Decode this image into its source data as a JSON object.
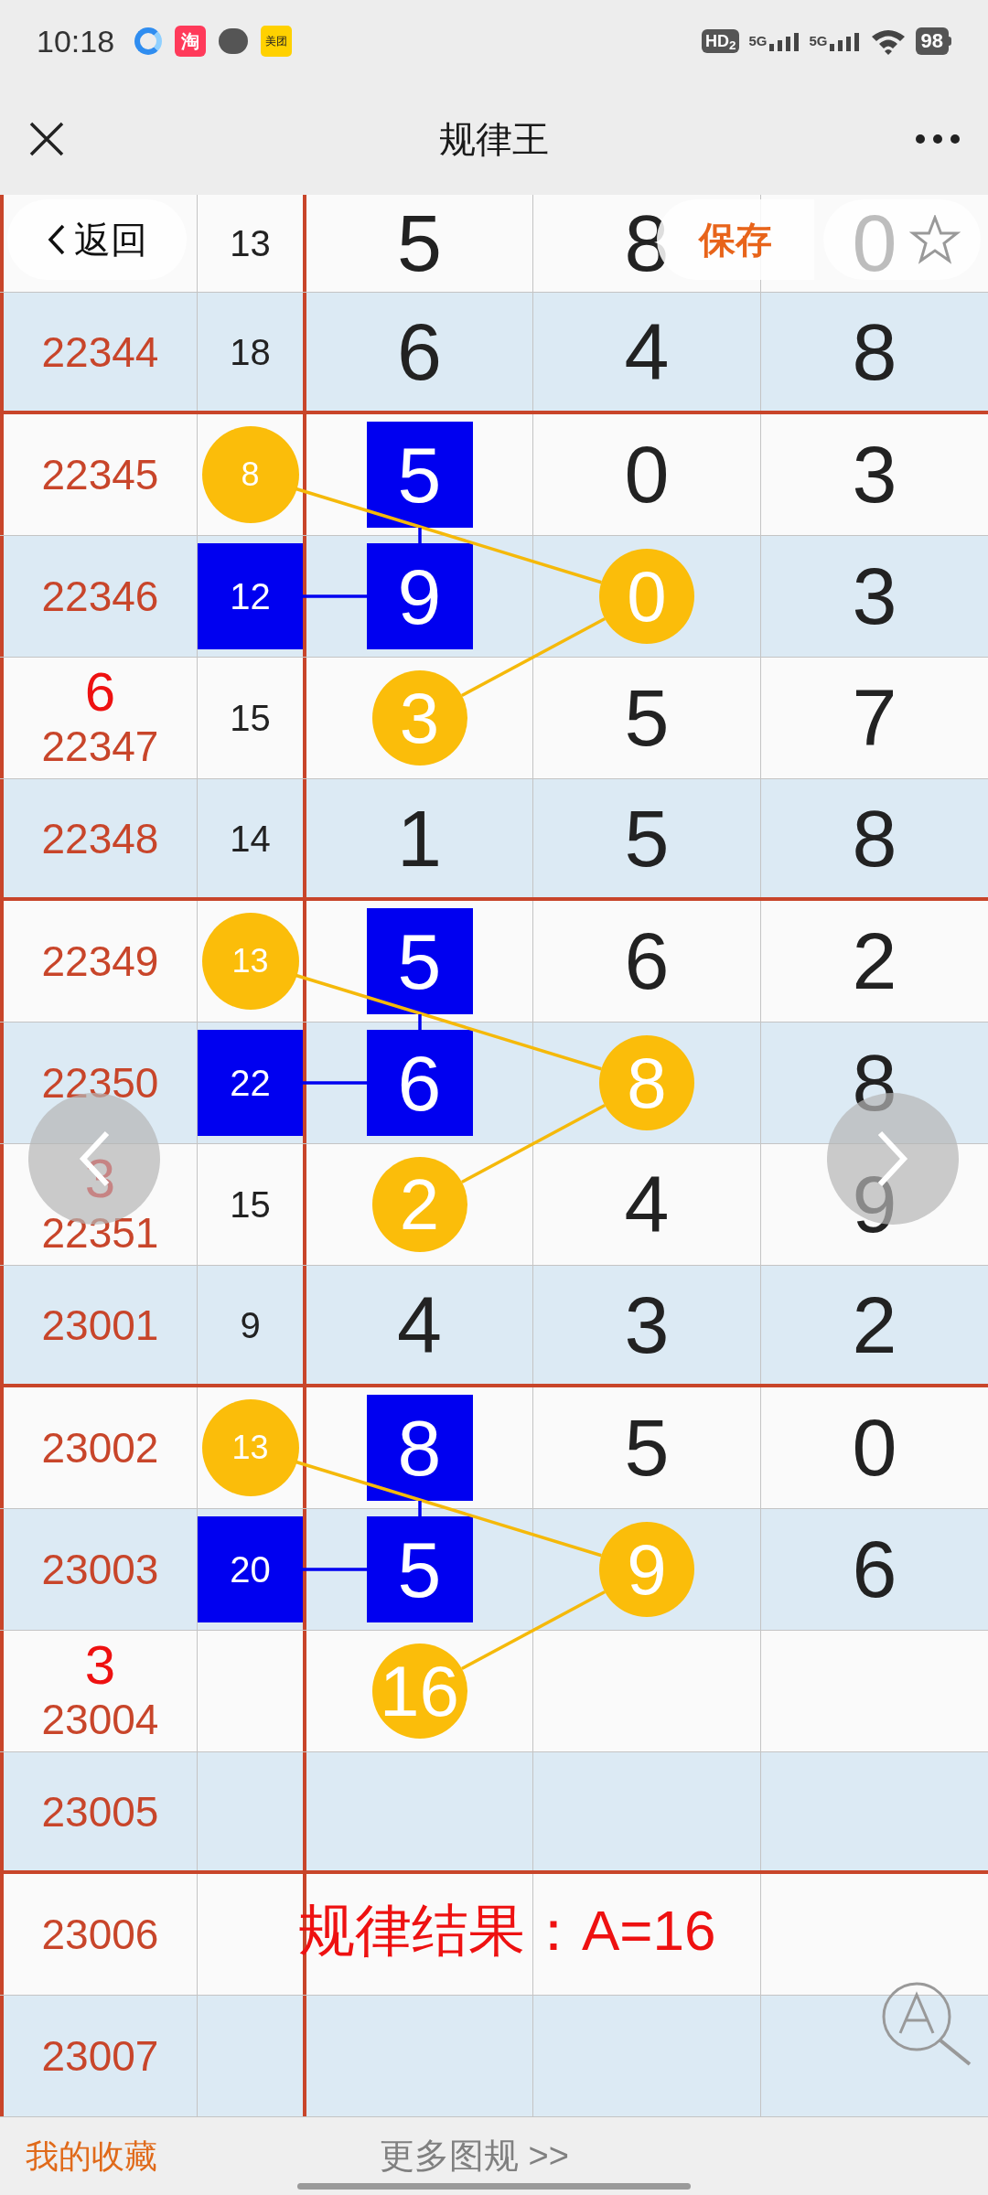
{
  "status_bar": {
    "time": "10:18",
    "app_icons": [
      {
        "kind": "ring"
      },
      {
        "kind": "red-tile",
        "label": "淘"
      },
      {
        "kind": "bubble"
      },
      {
        "kind": "yellow-tile",
        "label": "美团"
      }
    ],
    "hd_badge": "HD$_{2}$",
    "networks": [
      "5G",
      "5G"
    ],
    "battery": "98"
  },
  "title_bar": {
    "title": "规律王"
  },
  "overlay_buttons": {
    "back": "返回",
    "save": "保存"
  },
  "groups": [
    {
      "rows": [
        {
          "sum": {
            "text": "13"
          },
          "digits": [
            {
              "text": "5"
            },
            {
              "text": "8"
            },
            {
              "text": "0"
            }
          ]
        },
        {
          "period": "22344",
          "sum": {
            "text": "18"
          },
          "digits": [
            {
              "text": "6"
            },
            {
              "text": "4"
            },
            {
              "text": "8"
            }
          ]
        }
      ]
    },
    {
      "rows": [
        {
          "period": "22345",
          "sum": {
            "text": "8",
            "kind": "circle"
          },
          "digits": [
            {
              "text": "5",
              "kind": "square"
            },
            {
              "text": "0"
            },
            {
              "text": "3"
            }
          ]
        },
        {
          "period": "22346",
          "sum": {
            "text": "12",
            "kind": "square"
          },
          "digits": [
            {
              "text": "9",
              "kind": "square"
            },
            {
              "text": "0",
              "kind": "circle"
            },
            {
              "text": "3"
            }
          ]
        },
        {
          "period": "22347",
          "note": "6",
          "sum": {
            "text": "15"
          },
          "digits": [
            {
              "text": "3",
              "kind": "circle"
            },
            {
              "text": "5"
            },
            {
              "text": "7"
            }
          ]
        },
        {
          "period": "22348",
          "sum": {
            "text": "14"
          },
          "digits": [
            {
              "text": "1"
            },
            {
              "text": "5"
            },
            {
              "text": "8"
            }
          ]
        }
      ]
    },
    {
      "rows": [
        {
          "period": "22349",
          "sum": {
            "text": "13",
            "kind": "circle"
          },
          "digits": [
            {
              "text": "5",
              "kind": "square"
            },
            {
              "text": "6"
            },
            {
              "text": "2"
            }
          ]
        },
        {
          "period": "22350",
          "sum": {
            "text": "22",
            "kind": "square"
          },
          "digits": [
            {
              "text": "6",
              "kind": "square"
            },
            {
              "text": "8",
              "kind": "circle"
            },
            {
              "text": "8"
            }
          ]
        },
        {
          "period": "22351",
          "note": "3",
          "sum": {
            "text": "15"
          },
          "digits": [
            {
              "text": "2",
              "kind": "circle"
            },
            {
              "text": "4"
            },
            {
              "text": "9"
            }
          ]
        },
        {
          "period": "23001",
          "sum": {
            "text": "9"
          },
          "digits": [
            {
              "text": "4"
            },
            {
              "text": "3"
            },
            {
              "text": "2"
            }
          ]
        }
      ]
    },
    {
      "rows": [
        {
          "period": "23002",
          "sum": {
            "text": "13",
            "kind": "circle"
          },
          "digits": [
            {
              "text": "8",
              "kind": "square"
            },
            {
              "text": "5"
            },
            {
              "text": "0"
            }
          ]
        },
        {
          "period": "23003",
          "sum": {
            "text": "20",
            "kind": "square"
          },
          "digits": [
            {
              "text": "5",
              "kind": "square"
            },
            {
              "text": "9",
              "kind": "circle"
            },
            {
              "text": "6"
            }
          ]
        },
        {
          "period": "23004",
          "note": "3",
          "digits": [
            {
              "text": "16",
              "kind": "circle"
            }
          ]
        },
        {
          "period": "23005"
        }
      ]
    },
    {
      "rows": [
        {
          "period": "23006"
        },
        {
          "period": "23007"
        }
      ]
    }
  ],
  "result": "规律结果：A=16",
  "footer": {
    "favorites": "我的收藏",
    "more": "更多图规 >>"
  }
}
